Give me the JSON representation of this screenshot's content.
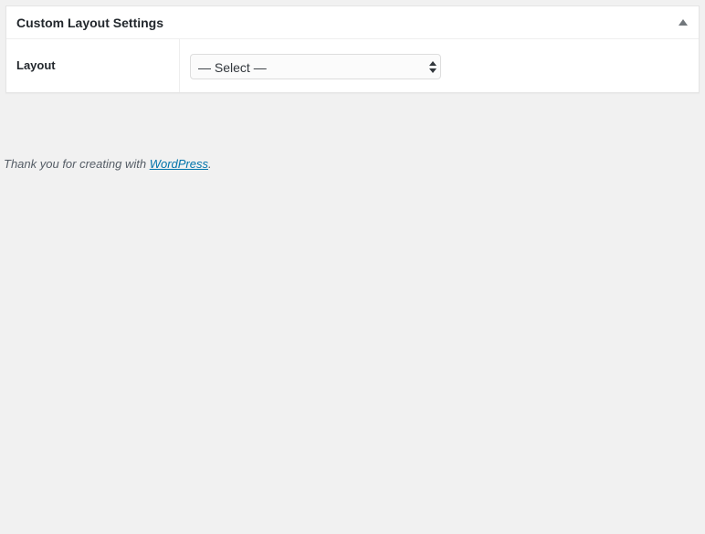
{
  "metabox": {
    "title": "Custom Layout Settings",
    "toggle_icon": "triangle-up-icon"
  },
  "layout_field": {
    "label": "Layout",
    "selected_value": "— Select —",
    "arrow_icon": "select-arrows-icon"
  },
  "footer": {
    "text_prefix": "Thank you for creating with ",
    "link_text": "WordPress",
    "text_suffix": "."
  },
  "colors": {
    "page_background": "#f1f1f1",
    "panel_background": "#ffffff",
    "link": "#0073aa",
    "text": "#23282d"
  }
}
